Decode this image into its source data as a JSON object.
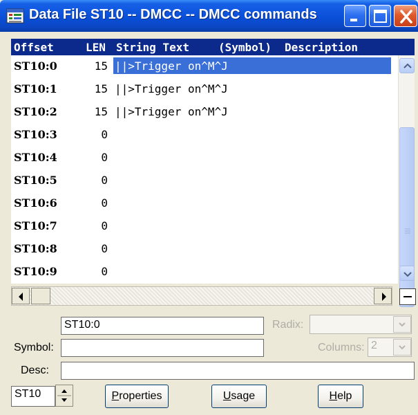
{
  "window": {
    "title": "Data File ST10  --  DMCC  --  DMCC commands"
  },
  "columns": {
    "offset": "Offset",
    "len": "LEN",
    "string_text": "String Text",
    "symbol": "(Symbol)",
    "description": "Description"
  },
  "rows": [
    {
      "offset": "ST10:0",
      "len": "15",
      "text": "||>Trigger on^M^J"
    },
    {
      "offset": "ST10:1",
      "len": "15",
      "text": "||>Trigger on^M^J"
    },
    {
      "offset": "ST10:2",
      "len": "15",
      "text": "||>Trigger on^M^J"
    },
    {
      "offset": "ST10:3",
      "len": "0",
      "text": ""
    },
    {
      "offset": "ST10:4",
      "len": "0",
      "text": ""
    },
    {
      "offset": "ST10:5",
      "len": "0",
      "text": ""
    },
    {
      "offset": "ST10:6",
      "len": "0",
      "text": ""
    },
    {
      "offset": "ST10:7",
      "len": "0",
      "text": ""
    },
    {
      "offset": "ST10:8",
      "len": "0",
      "text": ""
    },
    {
      "offset": "ST10:9",
      "len": "0",
      "text": ""
    }
  ],
  "selected_row": 0,
  "form": {
    "address_value": "ST10:0",
    "radix_label": "Radix:",
    "radix_value": "",
    "symbol_label": "Symbol:",
    "symbol_value": "",
    "columns_label": "Columns:",
    "columns_value": "2",
    "desc_label": "Desc:",
    "desc_value": "",
    "file_value": "ST10"
  },
  "buttons": {
    "properties": {
      "accel": "P",
      "rest": "roperties"
    },
    "usage": {
      "accel": "U",
      "rest": "sage"
    },
    "help": {
      "accel": "H",
      "rest": "elp"
    }
  },
  "colors": {
    "titlebar": "#0a4fd8",
    "header_bg": "#0b2a8c",
    "selection": "#3a6fd8",
    "close_button": "#e05a2a"
  },
  "icons": [
    "app-icon",
    "minimize-icon",
    "maximize-icon",
    "close-icon",
    "scroll-up-icon",
    "scroll-down-icon",
    "scroll-left-icon",
    "scroll-right-icon",
    "collapse-icon",
    "chevron-down-icon",
    "spinner-up-icon",
    "spinner-down-icon"
  ]
}
